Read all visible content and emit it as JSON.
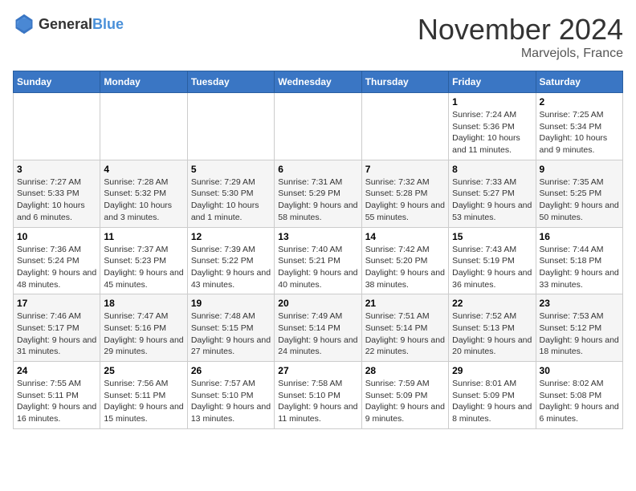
{
  "header": {
    "logo_general": "General",
    "logo_blue": "Blue",
    "month_title": "November 2024",
    "location": "Marvejols, France"
  },
  "weekdays": [
    "Sunday",
    "Monday",
    "Tuesday",
    "Wednesday",
    "Thursday",
    "Friday",
    "Saturday"
  ],
  "weeks": [
    [
      {
        "day": "",
        "info": ""
      },
      {
        "day": "",
        "info": ""
      },
      {
        "day": "",
        "info": ""
      },
      {
        "day": "",
        "info": ""
      },
      {
        "day": "",
        "info": ""
      },
      {
        "day": "1",
        "info": "Sunrise: 7:24 AM\nSunset: 5:36 PM\nDaylight: 10 hours and 11 minutes."
      },
      {
        "day": "2",
        "info": "Sunrise: 7:25 AM\nSunset: 5:34 PM\nDaylight: 10 hours and 9 minutes."
      }
    ],
    [
      {
        "day": "3",
        "info": "Sunrise: 7:27 AM\nSunset: 5:33 PM\nDaylight: 10 hours and 6 minutes."
      },
      {
        "day": "4",
        "info": "Sunrise: 7:28 AM\nSunset: 5:32 PM\nDaylight: 10 hours and 3 minutes."
      },
      {
        "day": "5",
        "info": "Sunrise: 7:29 AM\nSunset: 5:30 PM\nDaylight: 10 hours and 1 minute."
      },
      {
        "day": "6",
        "info": "Sunrise: 7:31 AM\nSunset: 5:29 PM\nDaylight: 9 hours and 58 minutes."
      },
      {
        "day": "7",
        "info": "Sunrise: 7:32 AM\nSunset: 5:28 PM\nDaylight: 9 hours and 55 minutes."
      },
      {
        "day": "8",
        "info": "Sunrise: 7:33 AM\nSunset: 5:27 PM\nDaylight: 9 hours and 53 minutes."
      },
      {
        "day": "9",
        "info": "Sunrise: 7:35 AM\nSunset: 5:25 PM\nDaylight: 9 hours and 50 minutes."
      }
    ],
    [
      {
        "day": "10",
        "info": "Sunrise: 7:36 AM\nSunset: 5:24 PM\nDaylight: 9 hours and 48 minutes."
      },
      {
        "day": "11",
        "info": "Sunrise: 7:37 AM\nSunset: 5:23 PM\nDaylight: 9 hours and 45 minutes."
      },
      {
        "day": "12",
        "info": "Sunrise: 7:39 AM\nSunset: 5:22 PM\nDaylight: 9 hours and 43 minutes."
      },
      {
        "day": "13",
        "info": "Sunrise: 7:40 AM\nSunset: 5:21 PM\nDaylight: 9 hours and 40 minutes."
      },
      {
        "day": "14",
        "info": "Sunrise: 7:42 AM\nSunset: 5:20 PM\nDaylight: 9 hours and 38 minutes."
      },
      {
        "day": "15",
        "info": "Sunrise: 7:43 AM\nSunset: 5:19 PM\nDaylight: 9 hours and 36 minutes."
      },
      {
        "day": "16",
        "info": "Sunrise: 7:44 AM\nSunset: 5:18 PM\nDaylight: 9 hours and 33 minutes."
      }
    ],
    [
      {
        "day": "17",
        "info": "Sunrise: 7:46 AM\nSunset: 5:17 PM\nDaylight: 9 hours and 31 minutes."
      },
      {
        "day": "18",
        "info": "Sunrise: 7:47 AM\nSunset: 5:16 PM\nDaylight: 9 hours and 29 minutes."
      },
      {
        "day": "19",
        "info": "Sunrise: 7:48 AM\nSunset: 5:15 PM\nDaylight: 9 hours and 27 minutes."
      },
      {
        "day": "20",
        "info": "Sunrise: 7:49 AM\nSunset: 5:14 PM\nDaylight: 9 hours and 24 minutes."
      },
      {
        "day": "21",
        "info": "Sunrise: 7:51 AM\nSunset: 5:14 PM\nDaylight: 9 hours and 22 minutes."
      },
      {
        "day": "22",
        "info": "Sunrise: 7:52 AM\nSunset: 5:13 PM\nDaylight: 9 hours and 20 minutes."
      },
      {
        "day": "23",
        "info": "Sunrise: 7:53 AM\nSunset: 5:12 PM\nDaylight: 9 hours and 18 minutes."
      }
    ],
    [
      {
        "day": "24",
        "info": "Sunrise: 7:55 AM\nSunset: 5:11 PM\nDaylight: 9 hours and 16 minutes."
      },
      {
        "day": "25",
        "info": "Sunrise: 7:56 AM\nSunset: 5:11 PM\nDaylight: 9 hours and 15 minutes."
      },
      {
        "day": "26",
        "info": "Sunrise: 7:57 AM\nSunset: 5:10 PM\nDaylight: 9 hours and 13 minutes."
      },
      {
        "day": "27",
        "info": "Sunrise: 7:58 AM\nSunset: 5:10 PM\nDaylight: 9 hours and 11 minutes."
      },
      {
        "day": "28",
        "info": "Sunrise: 7:59 AM\nSunset: 5:09 PM\nDaylight: 9 hours and 9 minutes."
      },
      {
        "day": "29",
        "info": "Sunrise: 8:01 AM\nSunset: 5:09 PM\nDaylight: 9 hours and 8 minutes."
      },
      {
        "day": "30",
        "info": "Sunrise: 8:02 AM\nSunset: 5:08 PM\nDaylight: 9 hours and 6 minutes."
      }
    ]
  ]
}
